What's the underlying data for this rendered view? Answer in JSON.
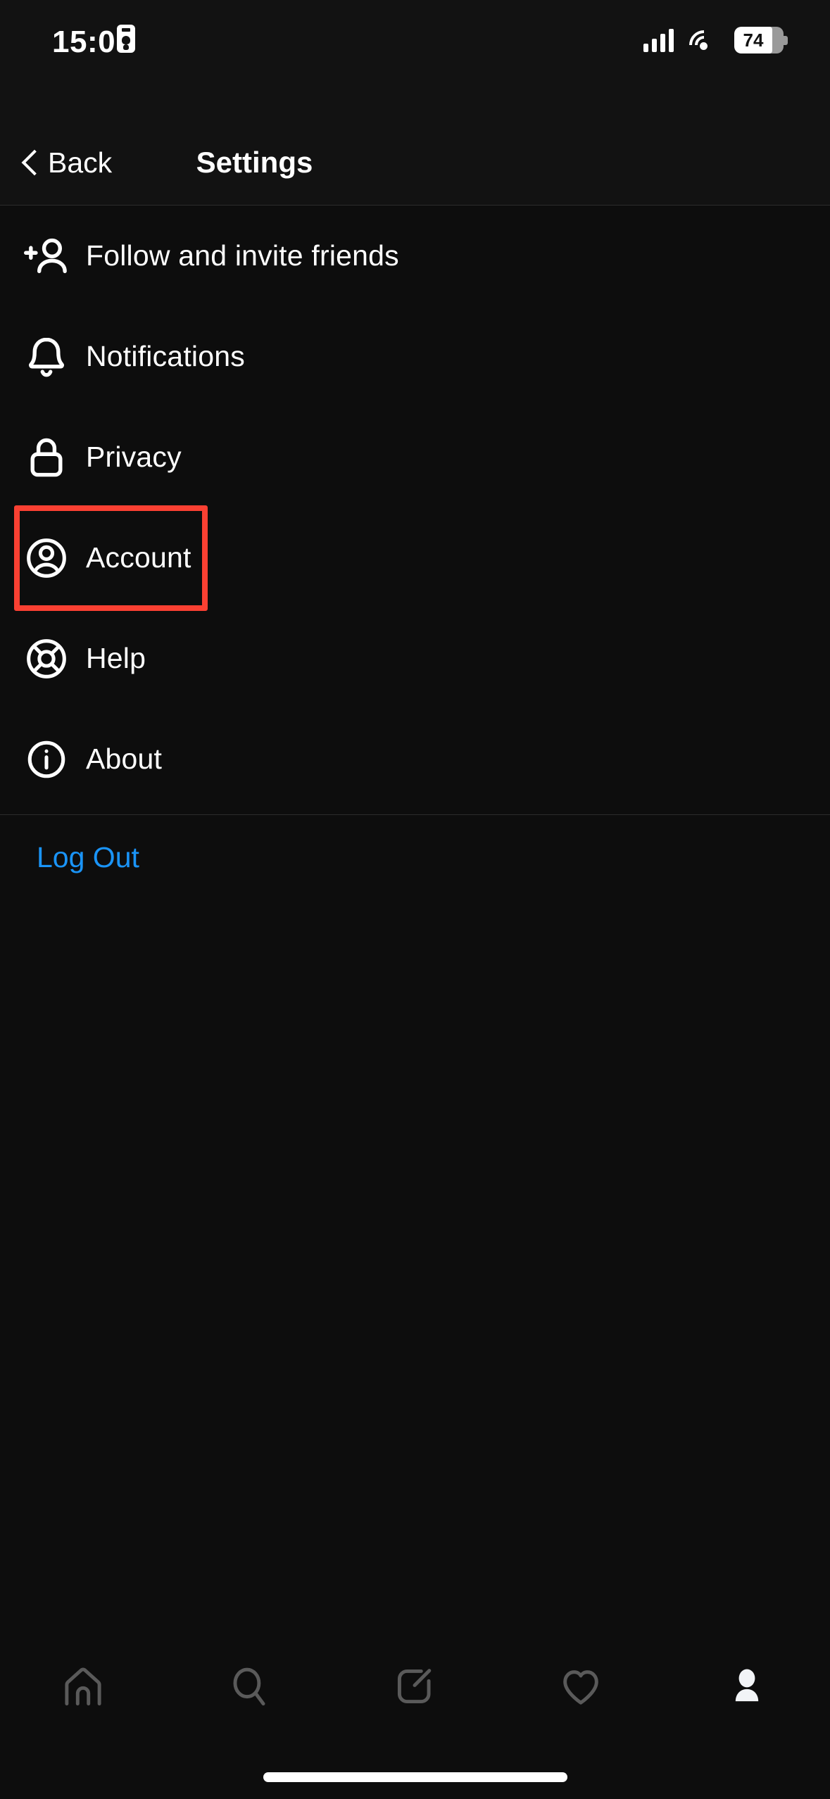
{
  "status_bar": {
    "time": "15:07",
    "id_icon": "id-card-icon",
    "signal_icon": "cellular-signal-icon",
    "wifi_icon": "wifi-icon",
    "battery_level": "74",
    "battery_icon": "battery-icon"
  },
  "header": {
    "back_label": "Back",
    "back_icon": "chevron-left-icon",
    "title": "Settings"
  },
  "menu": {
    "items": [
      {
        "label": "Follow and invite friends",
        "icon": "add-person-icon"
      },
      {
        "label": "Notifications",
        "icon": "bell-icon"
      },
      {
        "label": "Privacy",
        "icon": "lock-icon"
      },
      {
        "label": "Account",
        "icon": "account-circle-icon",
        "highlighted": true
      },
      {
        "label": "Help",
        "icon": "life-ring-icon"
      },
      {
        "label": "About",
        "icon": "info-circle-icon"
      }
    ]
  },
  "logout": {
    "label": "Log Out",
    "color": "#1a94f7"
  },
  "tab_bar": {
    "items": [
      {
        "icon": "home-icon",
        "active": false
      },
      {
        "icon": "search-icon",
        "active": false
      },
      {
        "icon": "compose-icon",
        "active": false
      },
      {
        "icon": "heart-icon",
        "active": false
      },
      {
        "icon": "profile-icon",
        "active": true
      }
    ]
  },
  "annotation": {
    "highlight_color": "#fa4032",
    "target": "Account"
  },
  "theme": {
    "background": "#0d0d0d",
    "surface": "#121212",
    "divider": "#2c2c2c",
    "text_primary": "#ffffff",
    "accent_link": "#1a94f7",
    "tab_inactive": "#5a5a5a"
  }
}
